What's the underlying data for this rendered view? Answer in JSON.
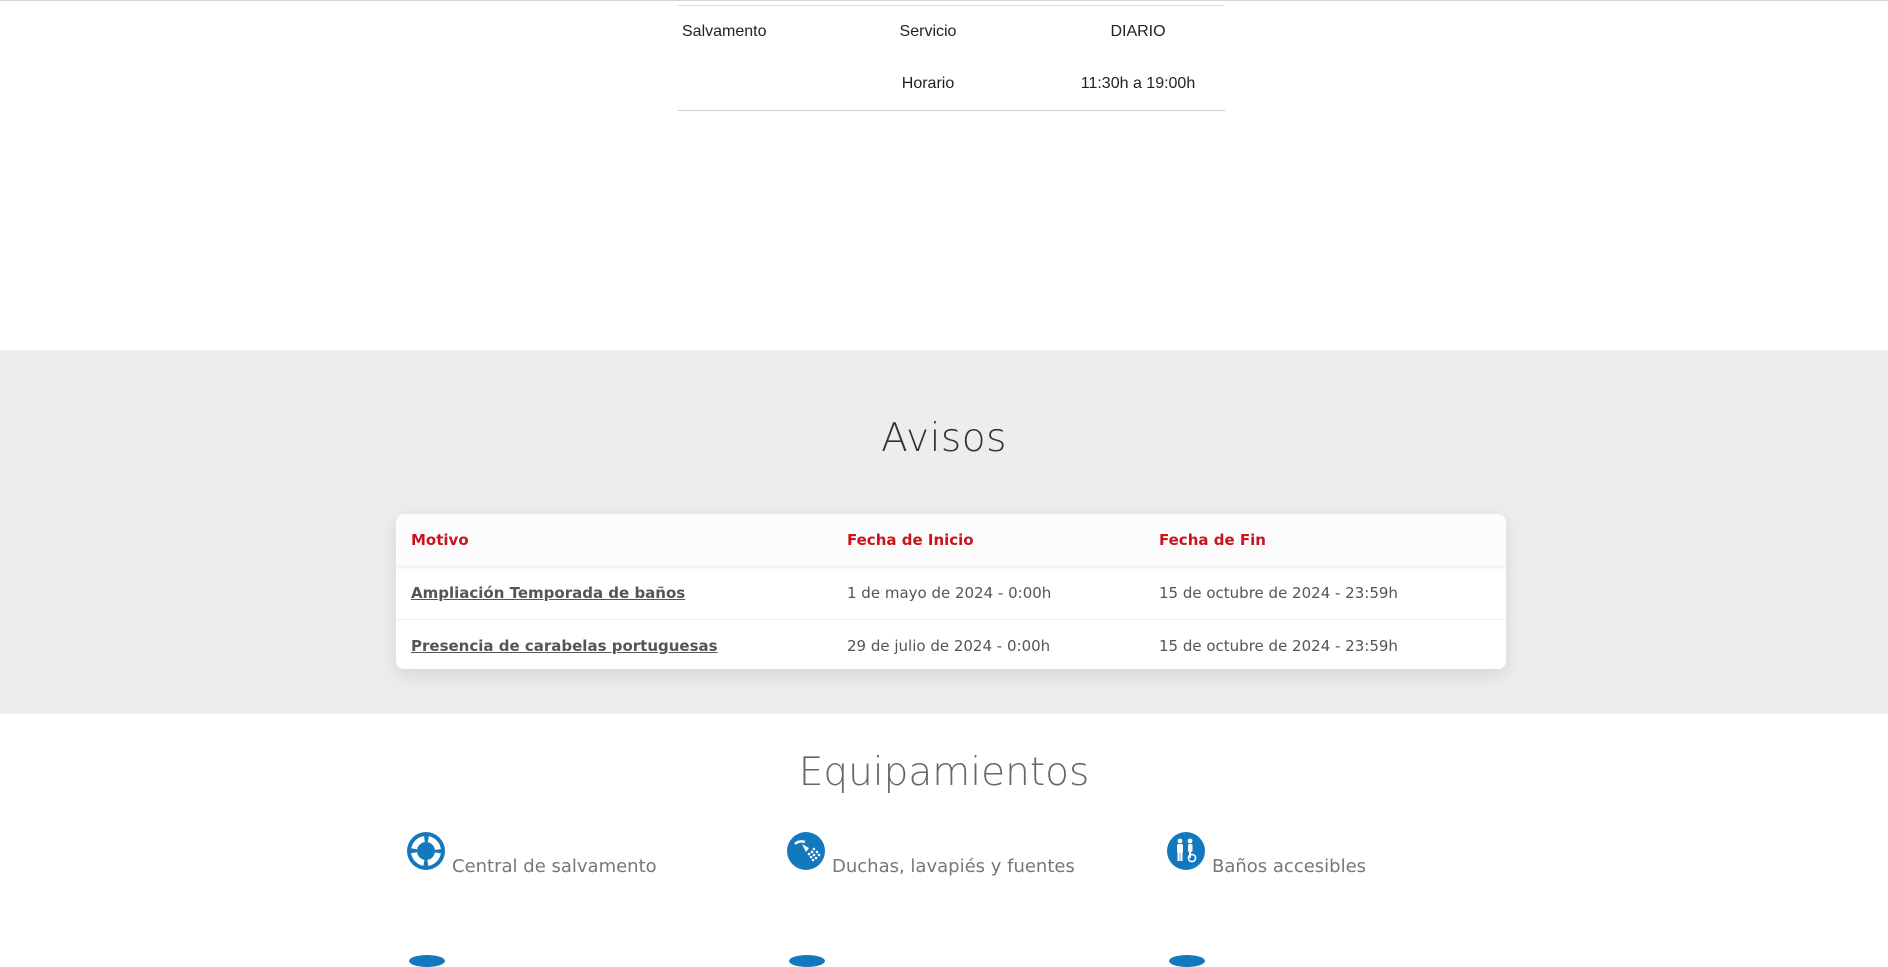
{
  "schedule": {
    "rows": [
      {
        "col1": "Salvamento",
        "col2": "Servicio",
        "col3": "DIARIO"
      },
      {
        "col1": "",
        "col2": "Horario",
        "col3": "11:30h a 19:00h"
      }
    ]
  },
  "avisos": {
    "title": "Avisos",
    "headers": {
      "motivo": "Motivo",
      "inicio": "Fecha de Inicio",
      "fin": "Fecha de Fin"
    },
    "rows": [
      {
        "motivo": "Ampliación Temporada de baños",
        "inicio": "1 de mayo de 2024 - 0:00h",
        "fin": "15 de octubre de 2024 - 23:59h"
      },
      {
        "motivo": "Presencia de carabelas portuguesas",
        "inicio": "29 de julio de 2024 - 0:00h",
        "fin": "15 de octubre de 2024 - 23:59h"
      }
    ],
    "colors": {
      "header_text": "#c8141d",
      "section_bg": "#ededed"
    }
  },
  "equipamientos": {
    "title": "Equipamientos",
    "items": [
      {
        "label": "Central de salvamento",
        "icon": "lifebuoy-icon"
      },
      {
        "label": "Duchas, lavapiés y fuentes",
        "icon": "shower-icon"
      },
      {
        "label": "Baños accesibles",
        "icon": "accessible-toilet-icon"
      }
    ],
    "icon_color": "#1478be"
  }
}
